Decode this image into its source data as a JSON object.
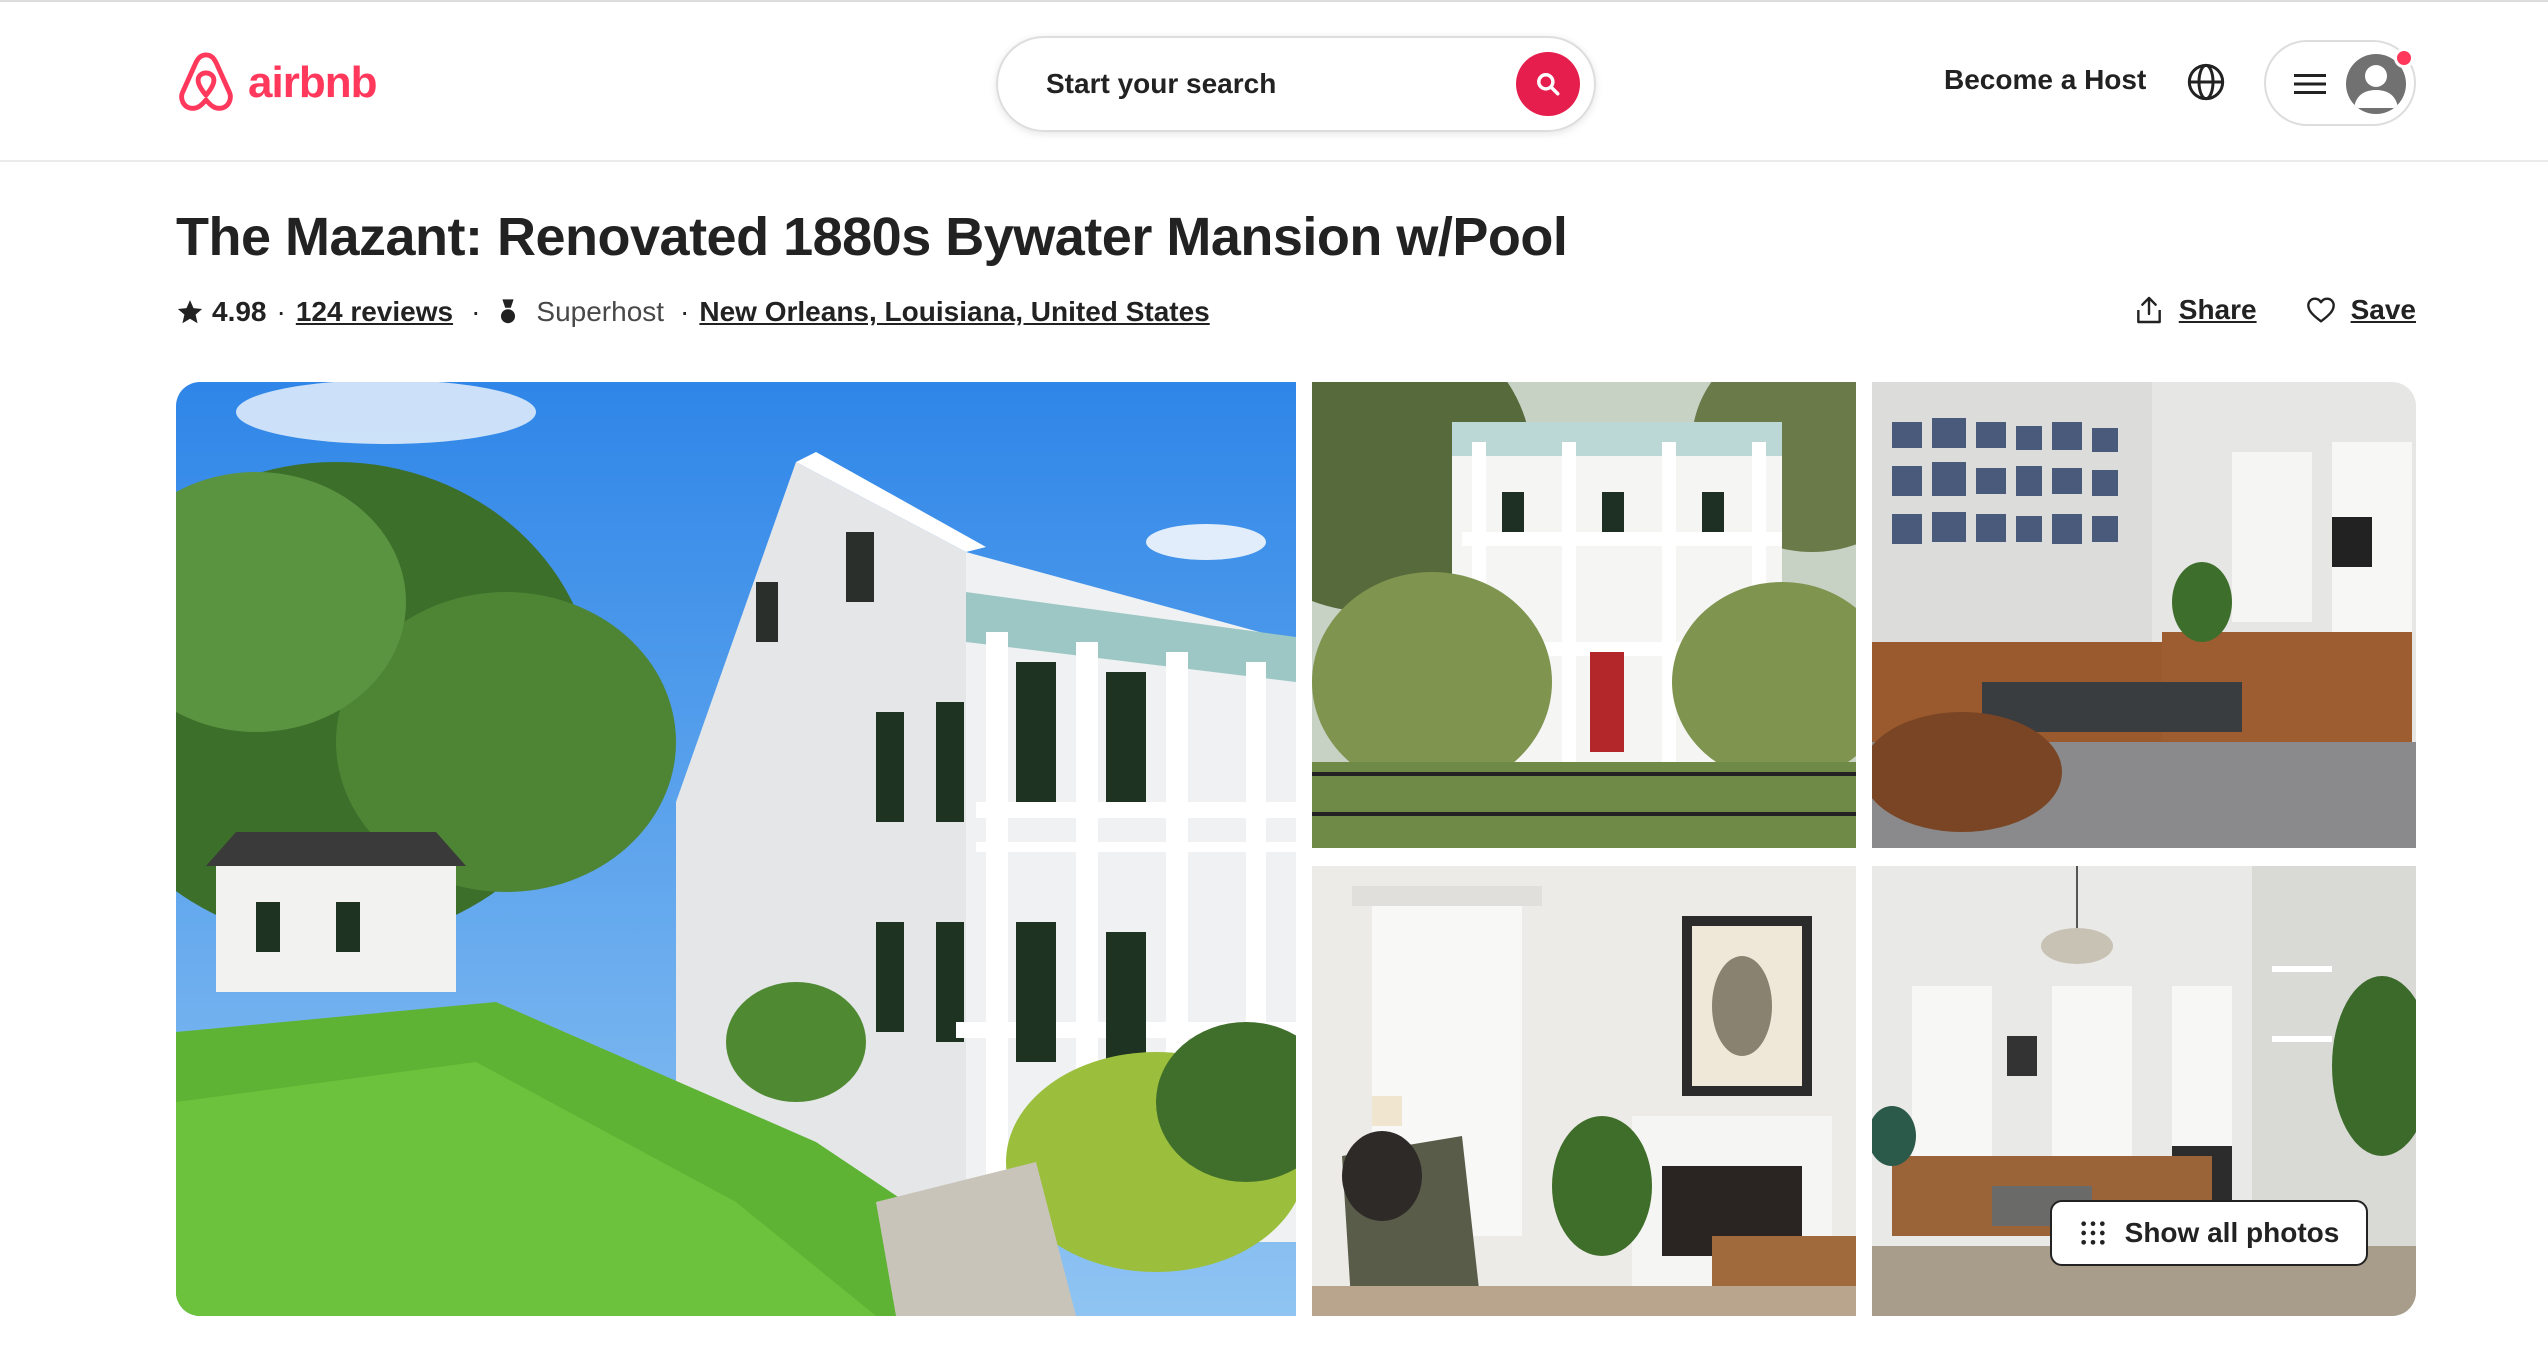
{
  "brand": {
    "name": "airbnb",
    "color": "#FF385C"
  },
  "search": {
    "label": "Start your search",
    "button_color": "#E61E4D"
  },
  "nav": {
    "host_label": "Become a Host",
    "globe_icon": "globe-icon",
    "menu_icon": "hamburger-icon",
    "avatar_icon": "user-avatar-icon",
    "has_notification": true
  },
  "listing": {
    "title": "The Mazant: Renovated 1880s Bywater Mansion w/Pool",
    "rating": "4.98",
    "reviews_label": "124 reviews",
    "host_status": "Superhost",
    "location": "New Orleans, Louisiana, United States"
  },
  "actions": {
    "share_label": "Share",
    "save_label": "Save"
  },
  "gallery": {
    "show_all_label": "Show all photos",
    "photos": [
      {
        "alt": "exterior-side-view"
      },
      {
        "alt": "front-facade-with-gate"
      },
      {
        "alt": "living-room-gallery-wall"
      },
      {
        "alt": "sitting-area-with-pelican-print"
      },
      {
        "alt": "parlor-with-chandelier"
      }
    ]
  }
}
